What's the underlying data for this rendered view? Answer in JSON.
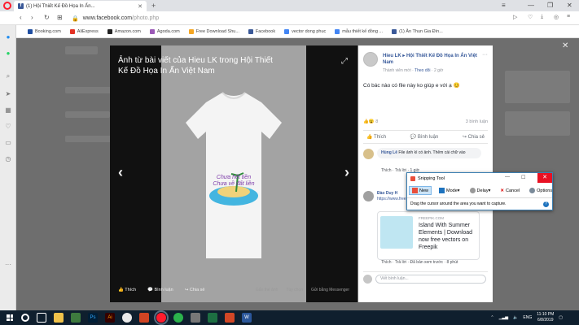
{
  "browser": {
    "tab_title": "(1) Hội Thiết Kế Đồ Họa In Ấn...",
    "tab_favicon": "f",
    "new_tab": "+",
    "url_host": "www.facebook.com",
    "url_path": "/photo.php",
    "window_controls": [
      "≡",
      "—",
      "❐",
      "✕"
    ]
  },
  "bookmarks": [
    {
      "label": "Booking.com",
      "color": "#1f4ea1"
    },
    {
      "label": "AliExpress",
      "color": "#e43225"
    },
    {
      "label": "Amazon.com",
      "color": "#222222"
    },
    {
      "label": "Agoda.com",
      "color": "#9b59b6"
    },
    {
      "label": "Free Download Shu...",
      "color": "#f5a623"
    },
    {
      "label": "Facebook",
      "color": "#3b5998"
    },
    {
      "label": "vector dong phuc",
      "color": "#4285f4"
    },
    {
      "label": "mẫu thiết kế đồng ...",
      "color": "#4285f4"
    },
    {
      "label": "(1) Ăn Thun Gia Đìn...",
      "color": "#3b5998"
    }
  ],
  "photo": {
    "title": "Ảnh từ bài viết của Hieu LK trong Hội Thiết Kế Đồ Họa In Ấn Việt Nam",
    "shirt_text_line1": "Chưa hết tiền",
    "shirt_text_line2": "Chưa về đất liền",
    "like_label": "Thích",
    "comment_label": "Bình luận",
    "share_label": "Chia sẻ",
    "footer_right": [
      "Gắn thẻ ảnh",
      "Tùy chọn",
      "Gửi bằng Messenger"
    ]
  },
  "post": {
    "author": "Hieu LK",
    "group": "Hội Thiết Kế Đồ Họa In Ấn Việt Nam",
    "member_badge": "Thành viên mới",
    "follow": "Theo dõi",
    "time": "2 giờ",
    "text": "Có bác nào có file này ko giúp e với ạ 😊",
    "reactions_count": "8",
    "comments_count": "3 bình luận",
    "like": "Thích",
    "comment": "Bình luận",
    "share": "Chia sẻ"
  },
  "comments": [
    {
      "author": "Hùng Lê",
      "text": "File ảnh kì có ảnh. Thêm cái chữ vào",
      "actions": "Thích · Trả lời · 1 giờ"
    },
    {
      "author": "Đào Duy H",
      "text": "https://www.freepik.com/free-vector/island-summer-el...",
      "actions": "Thích · Trả lời · Đã bản xem trước · 8 phút"
    }
  ],
  "link_card": {
    "domain": "FREEPIK.COM",
    "title": "Island With Summer Elements | Download now free vectors on Freepik"
  },
  "write_comment": "Viết bình luận...",
  "snipping": {
    "title": "Snipping Tool",
    "new": "New",
    "mode": "Mode",
    "delay": "Delay",
    "cancel": "Cancel",
    "options": "Options",
    "hint": "Drag the cursor around the area you want to capture.",
    "help": "?"
  },
  "taskbar": {
    "lang": "ENG",
    "time": "11:10 PM",
    "date": "6/8/2019"
  }
}
